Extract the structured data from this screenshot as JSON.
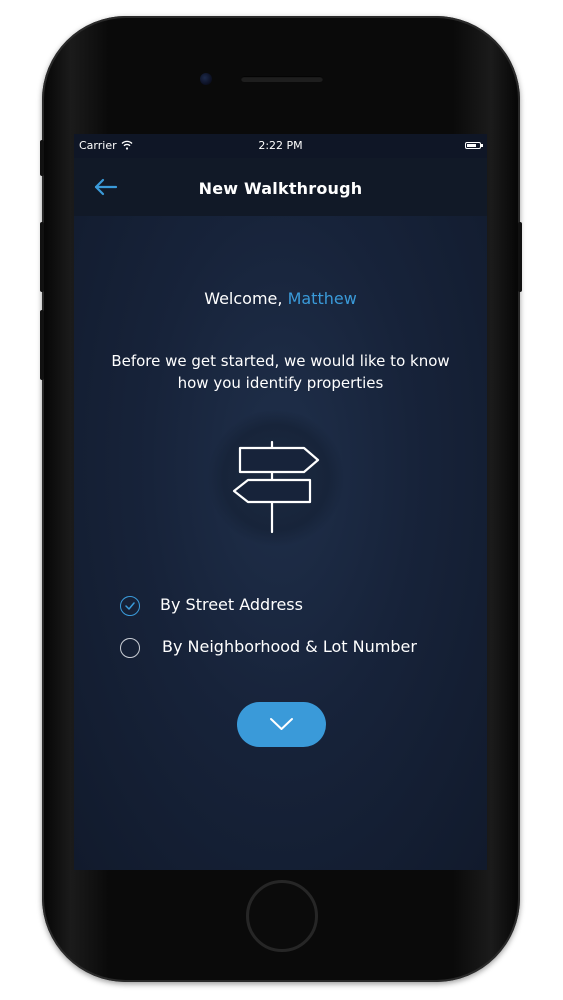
{
  "status_bar": {
    "carrier": "Carrier",
    "time": "2:22 PM"
  },
  "nav": {
    "title": "New Walkthrough",
    "back_icon": "arrow-left-icon"
  },
  "welcome": {
    "prefix": "Welcome, ",
    "name": "Matthew"
  },
  "intro_text": "Before we get started, we would like to know how you identify properties",
  "illustration_icon": "signpost-icon",
  "options": [
    {
      "label": "By Street Address",
      "selected": true
    },
    {
      "label": "By Neighborhood & Lot Number",
      "selected": false
    }
  ],
  "next_button_icon": "chevron-down-icon",
  "colors": {
    "accent": "#3a9ad9",
    "screen_bg": "#17233a",
    "nav_bg": "#111927",
    "text": "#ffffff"
  }
}
